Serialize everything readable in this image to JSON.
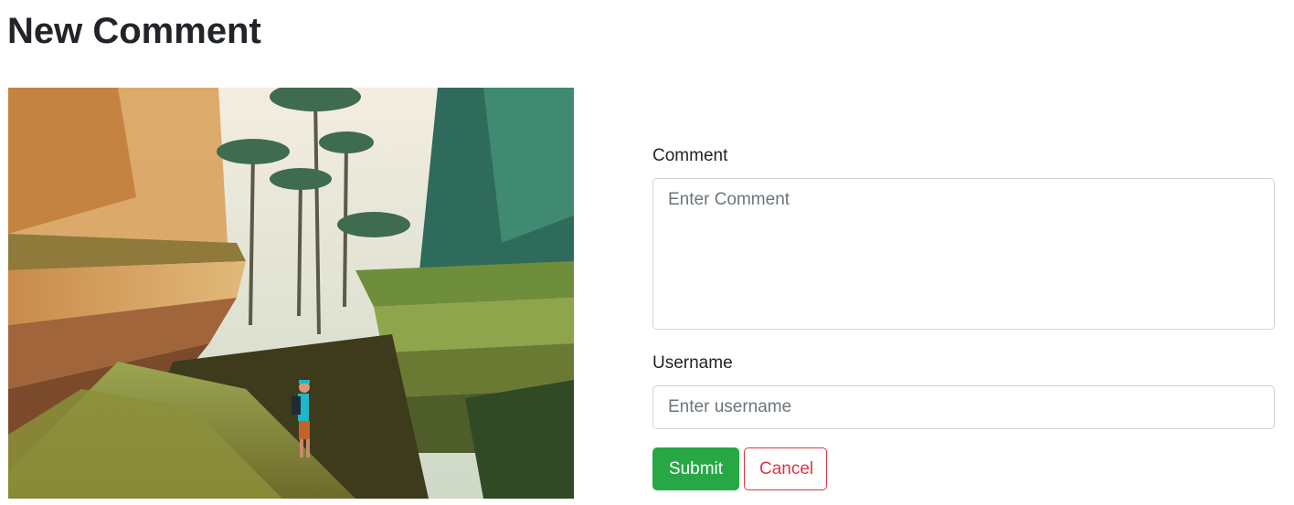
{
  "page": {
    "title": "New Comment"
  },
  "image": {
    "description_icon": "landscape-photo"
  },
  "form": {
    "comment_label": "Comment",
    "comment_placeholder": "Enter Comment",
    "comment_value": "",
    "username_label": "Username",
    "username_placeholder": "Enter username",
    "username_value": "",
    "submit_label": "Submit",
    "cancel_label": "Cancel"
  },
  "colors": {
    "submit_bg": "#28a745",
    "cancel_border": "#dc3545",
    "text": "#212529",
    "placeholder": "#6c757d"
  }
}
